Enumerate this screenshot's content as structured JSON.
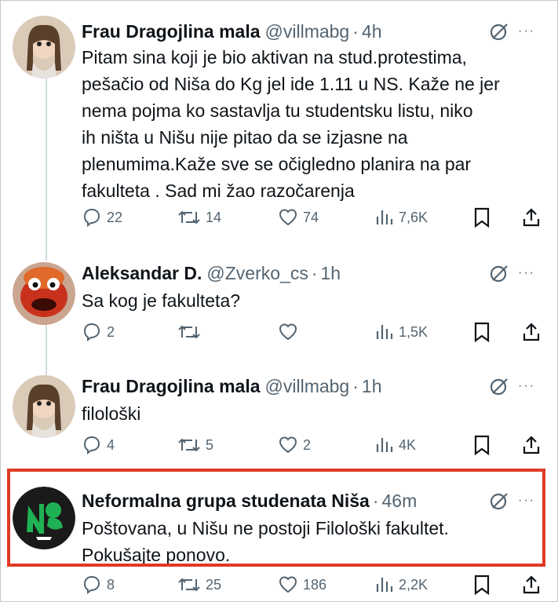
{
  "tweets": [
    {
      "name": "Frau Dragojlina mala",
      "handle": "@villmabg",
      "time": "4h",
      "text_lines": [
        "Pitam sina koji je bio aktivan na stud.protestima,",
        "pešačio od Niša do Kg jel ide 1.11 u NS. Kaže ne jer",
        "nema pojma ko sastavlja tu studentsku listu, niko",
        "ih ništa u Nišu nije pitao da se izjasne na",
        "plenumima.Kaže sve se očigledno planira na par",
        "fakulteta . Sad mi žao razočarenja"
      ],
      "replies": "22",
      "reposts": "14",
      "likes": "74",
      "views": "7,6K"
    },
    {
      "name": "Aleksandar D.",
      "handle": "@Zverko_cs",
      "time": "1h",
      "text_lines": [
        "Sa kog je fakulteta?"
      ],
      "replies": "2",
      "reposts": "",
      "likes": "",
      "views": "1,5K"
    },
    {
      "name": "Frau Dragojlina mala",
      "handle": "@villmabg",
      "time": "1h",
      "text_lines": [
        "filološki"
      ],
      "replies": "4",
      "reposts": "5",
      "likes": "2",
      "views": "4K"
    },
    {
      "name": "Neformalna grupa studenata Niša",
      "handle": "",
      "time": "46m",
      "text_lines": [
        "Poštovana, u Nišu ne postoji Filološki fakultet.",
        "Pokušajte ponovo."
      ],
      "replies": "8",
      "reposts": "25",
      "likes": "186",
      "views": "2,2K"
    }
  ],
  "separator": "·",
  "more_label": "···",
  "highlight_color": "#e03a25",
  "icons": [
    "grok-icon",
    "more-icon",
    "reply-icon",
    "repost-icon",
    "like-icon",
    "views-icon",
    "bookmark-icon",
    "share-icon"
  ]
}
